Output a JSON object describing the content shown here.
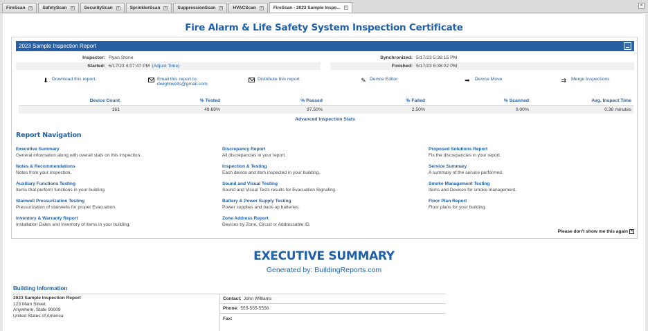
{
  "tabs": [
    {
      "label": "FireScan"
    },
    {
      "label": "SafetyScan"
    },
    {
      "label": "SecurityScan"
    },
    {
      "label": "SprinklerScan"
    },
    {
      "label": "SuppressionScan"
    },
    {
      "label": "HVACScan"
    },
    {
      "label": "FireScan - 2023 Sample Inspe..."
    }
  ],
  "certificate_title": "Fire Alarm & Life Safety System Inspection Certificate",
  "report": {
    "header": "2023 Sample Inspection Report",
    "inspector_label": "Inspector:",
    "inspector": "Ryan Stone",
    "started_label": "Started:",
    "started": "5/17/23 4:07:47 PM",
    "adjust_time": "(Adjust Time)",
    "synchronized_label": "Synchronized:",
    "synchronized": "5/17/23 5:38:15 PM",
    "finished_label": "Finished:",
    "finished": "5/17/23 6:38:02 PM"
  },
  "actions": {
    "download": "Download this report.",
    "email_line1": "Email this report to:",
    "email_line2": "dwightwells@gmail.com",
    "distribute": "Distribute this report",
    "device_editor": "Device Editor",
    "device_move": "Device Move",
    "merge": "Merge Inspections"
  },
  "stats": {
    "headers": [
      "Device Count",
      "% Tested",
      "% Passed",
      "% Failed",
      "% Scanned",
      "Avg. Inspect Time"
    ],
    "values": [
      "161",
      "49.69%",
      "97.50%",
      "2.50%",
      "0.00%",
      "0.38 minutes"
    ],
    "advanced": "Advanced Inspection Stats"
  },
  "nav": {
    "title": "Report Navigation",
    "items": [
      {
        "title": "Executive Summary",
        "desc": "General information along with overall stats on this inspection."
      },
      {
        "title": "Discrepancy Report",
        "desc": "All discrepancies in your report."
      },
      {
        "title": "Proposed Solutions Report",
        "desc": "Fix the discrepancies in your report."
      },
      {
        "title": "Notes & Recommendations",
        "desc": "Notes from your inspection."
      },
      {
        "title": "Inspection & Testing",
        "desc": "Each device and item inspected in your building."
      },
      {
        "title": "Service Summary",
        "desc": "A summary of the service performed."
      },
      {
        "title": "Auxiliary Functions Testing",
        "desc": "Items that perform functions in your building."
      },
      {
        "title": "Sound and Visual Testing",
        "desc": "Sound and Visual Tests results for Evacuation Signaling."
      },
      {
        "title": "Smoke Management Testing",
        "desc": "Items and Devices for smoke management."
      },
      {
        "title": "Stairwell Pressurization Testing",
        "desc": "Pressurization of stairwells for proper Evacuation."
      },
      {
        "title": "Battery & Power Supply Testing",
        "desc": "Power supplies and back-up batteries."
      },
      {
        "title": "Floor Plan Report",
        "desc": "Floor plans for your building."
      },
      {
        "title": "Inventory & Warranty Report",
        "desc": "Installation Dates and Inventory of items in your building."
      },
      {
        "title": "Zone Address Report",
        "desc": "Devices by Zone, Circuit or Addressable ID."
      }
    ],
    "dont_show": "Please don't show me this again"
  },
  "exec": {
    "title": "EXECUTIVE SUMMARY",
    "subtitle": "Generated by: BuildingReports.com"
  },
  "building": {
    "title": "Building Information",
    "name": "2023 Sample Inspection Report",
    "address1": "123 Main Street",
    "address2": "Anywhere, State 90009",
    "country": "United States of America",
    "contact_label": "Contact:",
    "contact": "John Williams",
    "phone_label": "Phone:",
    "phone": "555-555-5556",
    "fax_label": "Fax:",
    "fax": ""
  },
  "colors": {
    "accent": "#1f5fa8",
    "header_bar": "#285fa3"
  }
}
